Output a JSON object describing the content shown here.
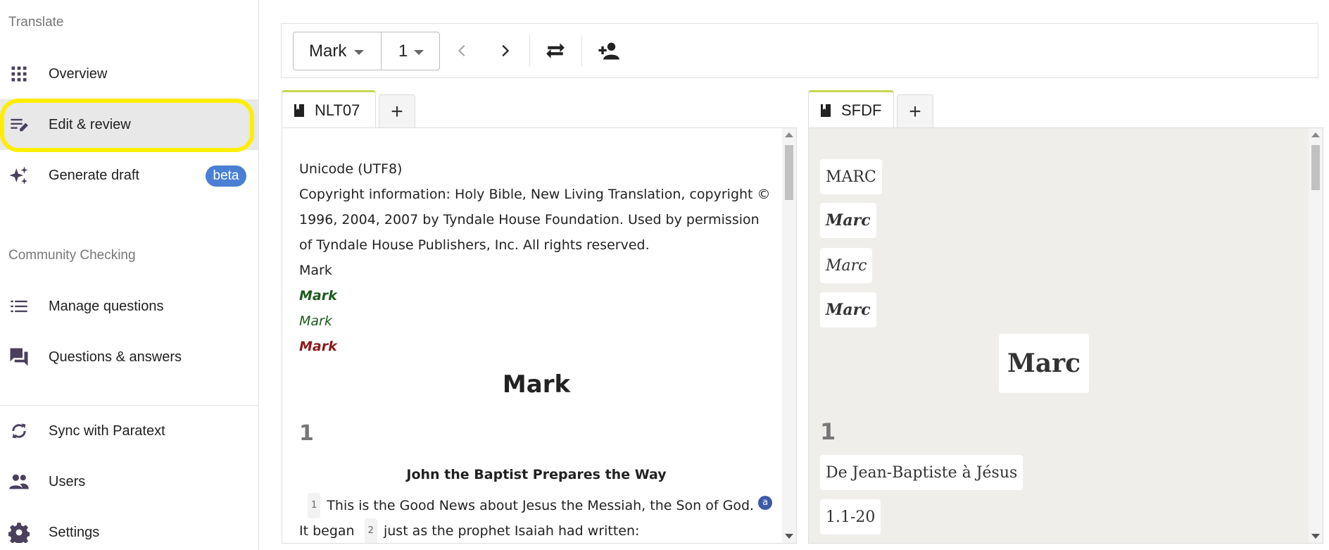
{
  "sidebar": {
    "translate_title": "Translate",
    "community_title": "Community Checking",
    "items": [
      {
        "label": "Overview"
      },
      {
        "label": "Edit & review"
      },
      {
        "label": "Generate draft",
        "badge": "beta"
      },
      {
        "label": "Manage questions"
      },
      {
        "label": "Questions & answers"
      },
      {
        "label": "Sync with Paratext"
      },
      {
        "label": "Users"
      },
      {
        "label": "Settings"
      }
    ]
  },
  "toolbar": {
    "book": "Mark",
    "chapter": "1"
  },
  "left_panel": {
    "tab_label": "NLT07",
    "add_tab": "+",
    "lines": {
      "encoding": "Unicode (UTF8)",
      "copyright": "Copyright information: Holy Bible, New Living Translation, copyright © 1996, 2004, 2007 by Tyndale House Foundation. Used by permission of Tyndale House Publishers, Inc. All rights reserved.",
      "book_plain": "Mark",
      "book_bold": "Mark",
      "book_italic": "Mark",
      "book_red": "Mark",
      "book_title": "Mark",
      "chapter": "1",
      "heading": "John the Baptist Prepares the Way",
      "v1_num": "1",
      "v1_text": "This is the Good News about Jesus the Messiah, the Son of God.",
      "footnote": "a",
      "v2_pre": "It began",
      "v2_num": "2",
      "v2_text": "just as the prophet Isaiah had written:"
    }
  },
  "right_panel": {
    "tab_label": "SFDF",
    "add_tab": "+",
    "lines": {
      "book_caps": "MARC",
      "book_bold": "Marc",
      "book_italic": "Marc",
      "book_bold2": "Marc",
      "book_title": "Marc",
      "chapter": "1",
      "heading": "De Jean-Baptiste à Jésus",
      "ref": "1.1-20"
    }
  },
  "colors": {
    "highlight": "#ffee00",
    "beta_badge": "#4a7fd4",
    "tab_accent": "#c7d65a",
    "green_text": "#1e5a1e",
    "red_text": "#8b1a1a",
    "footnote": "#3d5aa8"
  },
  "icons": {
    "overview": "grid-icon",
    "edit": "edit-lines-icon",
    "draft": "sparkle-icon",
    "questions": "list-icon",
    "answers": "forum-icon",
    "sync": "sync-icon",
    "users": "people-icon",
    "settings": "gear-icon"
  }
}
